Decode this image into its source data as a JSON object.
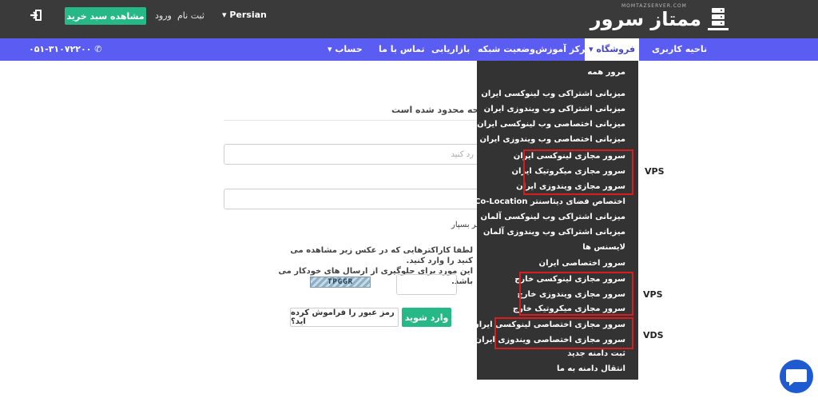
{
  "topbar": {
    "logo_text": "ممتاز سرور",
    "logo_sub": "MOMTAZSERVER.COM",
    "lang": "Persian",
    "signup": "ثبت نام",
    "login": "ورود",
    "cart": "مشاهده سبد خرید"
  },
  "nav": {
    "items": [
      {
        "label": "ناحیه کاربری"
      },
      {
        "label": "فروشگاه"
      },
      {
        "label": "مرکز آموزش"
      },
      {
        "label": "وضعیت شبکه"
      },
      {
        "label": "بازاریابی"
      },
      {
        "label": "تماس با ما"
      },
      {
        "label": "حساب"
      }
    ],
    "phone": "۰۵۱-۳۱۰۷۲۲۰۰"
  },
  "page": {
    "restricted": "صفحه محدود شده است",
    "email_placeholder": "رد کنید",
    "remember": "طر بسپار",
    "captcha_line1": "لطفا کاراکترهایی که در عکس زیر مشاهده می کنید را وارد کنید.",
    "captcha_line2": "این مورد برای جلوگیری از ارسال های خودکار می باشد.",
    "captcha_code": "TPGGR",
    "login_btn": "وارد شوید",
    "forgot_btn": "رمز عبور را فراموش کرده اید؟"
  },
  "dropdown": {
    "items": [
      {
        "label": "مرور همه"
      },
      {
        "label": "میزبانی اشتراکی وب لینوکسی ایران"
      },
      {
        "label": "میزبانی اشتراکی وب ویندوزی ایران"
      },
      {
        "label": "میزبانی اختصاصی وب لینوکسی ایران"
      },
      {
        "label": "میزبانی اختصاصی وب ویندوزی ایران"
      },
      {
        "label": "سرور مجازی لینوکسی ایران"
      },
      {
        "label": "سرور مجازی میکروتیک ایران"
      },
      {
        "label": "سرور مجازی ویندوزی ایران"
      },
      {
        "label": "اختصاص فضای دیتاسنتر Co-Location"
      },
      {
        "label": "میزبانی اشتراکی وب لینوکسی آلمان"
      },
      {
        "label": "میزبانی اشتراکی وب ویندوزی آلمان"
      },
      {
        "label": "لایسنس ها"
      },
      {
        "label": "سرور اختصاصی ایران"
      },
      {
        "label": "سرور مجازی لینوکسی خارج"
      },
      {
        "label": "سرور مجازی ویندوزی خارج"
      },
      {
        "label": "سرور مجازی میکروتیک خارج"
      },
      {
        "label": "سرور مجازی اختصاصی لینوکسی ایران"
      },
      {
        "label": "سرور مجازی اختصاصی ویندوزی ایران"
      },
      {
        "label": "ثبت دامنه جدید"
      },
      {
        "label": "انتقال دامنه به ما"
      }
    ]
  },
  "annotations": {
    "vps1": "VPS",
    "vps2": "VPS",
    "vds": "VDS"
  },
  "colors": {
    "topbar": "#3a3a3a",
    "nav": "#5b5cf2",
    "accent_green": "#26b987",
    "dropdown": "#333333",
    "highlight_red": "#d71d1d",
    "chat": "#1e5bd0"
  },
  "icons": [
    "logo-server-icon",
    "signout-icon",
    "phone-icon",
    "caret-down-icon",
    "chat-icon"
  ]
}
